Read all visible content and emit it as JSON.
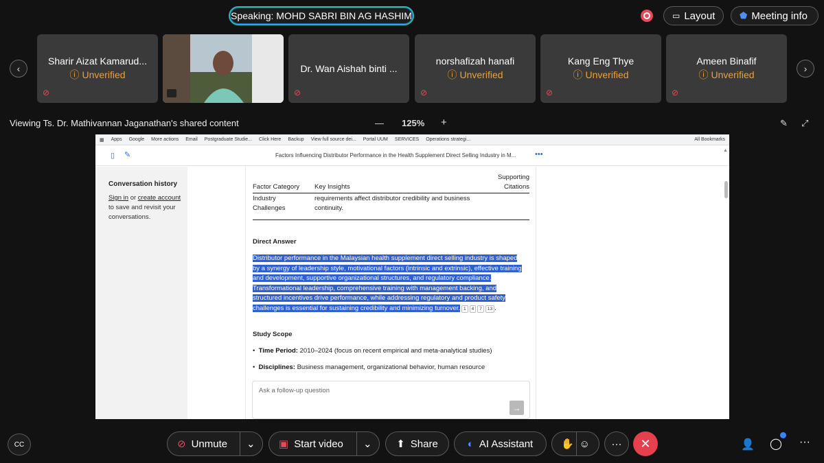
{
  "top": {
    "speaking": "Speaking: MOHD SABRI BIN AG HASHIM",
    "layout_label": "Layout",
    "meeting_info_label": "Meeting info"
  },
  "participants": [
    {
      "name": "Sharir Aizat Kamarud...",
      "status": "Unverified"
    },
    {
      "name": "",
      "status": ""
    },
    {
      "name": "Dr. Wan Aishah binti ...",
      "status": ""
    },
    {
      "name": "norshafizah hanafi",
      "status": "Unverified"
    },
    {
      "name": "Kang Eng Thye",
      "status": "Unverified"
    },
    {
      "name": "Ameen Binafif",
      "status": "Unverified"
    }
  ],
  "share": {
    "viewing": "Viewing Ts. Dr. Mathivannan Jaganathan's shared content",
    "zoom": "125%"
  },
  "browser": {
    "bookmarks": [
      "Apps",
      "Google",
      "More actions",
      "Email",
      "Postgraduate Studie...",
      "Click Here",
      "Backup",
      "View full source dei...",
      "Portal UUM",
      "SERVICES",
      "Operations strategi..."
    ],
    "all_bookmarks": "All Bookmarks",
    "doc_title": "Factors Influencing Distributor Performance in the Health Supplement Direct Selling Industry in M..."
  },
  "sidebar": {
    "heading": "Conversation history",
    "sign_in": "Sign in",
    "or": "or",
    "create_account": "create account",
    "rest": "to save and revisit your conversations."
  },
  "table": {
    "col1": "Factor Category",
    "col2": "Key Insights",
    "col3a": "Supporting",
    "col3b": "Citations",
    "row_cat1": "Industry",
    "row_cat2": "Challenges",
    "row_insight1": "requirements affect distributor credibility and business",
    "row_insight2": "continuity."
  },
  "answer": {
    "title": "Direct Answer",
    "lines": [
      "Distributor performance in the Malaysian health supplement direct selling industry is shaped",
      "by a synergy of leadership style, motivational factors (intrinsic and extrinsic), effective training",
      "and development, supportive organizational structures, and regulatory compliance.",
      "Transformational leadership, comprehensive training with management backing, and",
      "structured incentives drive performance, while addressing regulatory and product safety",
      "challenges is essential for sustaining credibility and minimizing turnover."
    ],
    "citations": [
      "1",
      "4",
      "7",
      "13"
    ]
  },
  "scope": {
    "title": "Study Scope",
    "b1_label": "Time Period:",
    "b1_text": "2010–2024 (focus on recent empirical and meta-analytical studies)",
    "b2_label": "Disciplines:",
    "b2_text": "Business management, organizational behavior, human resource"
  },
  "followup": {
    "placeholder": "Ask a follow-up question"
  },
  "toolbar": {
    "unmute": "Unmute",
    "start_video": "Start video",
    "share": "Share",
    "ai_assistant": "AI Assistant"
  },
  "colors": {
    "accent": "#2fb4a6",
    "end_call": "#e5404e",
    "unverified": "#f0a030",
    "highlight": "#2f5fd0"
  }
}
